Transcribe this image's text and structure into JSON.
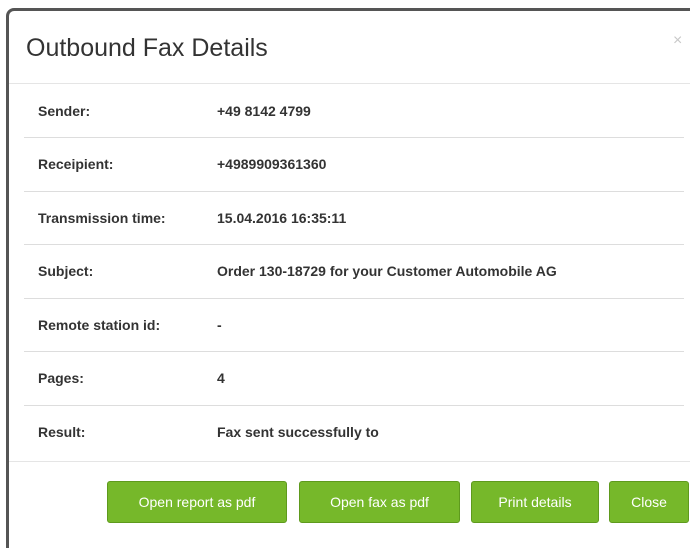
{
  "dialog": {
    "title": "Outbound Fax Details",
    "close_glyph": "×"
  },
  "details": [
    {
      "label": "Sender:",
      "value": "+49 8142 4799"
    },
    {
      "label": "Receipient:",
      "value": "+4989909361360"
    },
    {
      "label": "Transmission time:",
      "value": "15.04.2016 16:35:11"
    },
    {
      "label": "Subject:",
      "value": "Order 130-18729 for your Customer Automobile AG"
    },
    {
      "label": "Remote station id:",
      "value": "-"
    },
    {
      "label": "Pages:",
      "value": "4"
    },
    {
      "label": "Result:",
      "value": "Fax sent successfully to"
    }
  ],
  "buttons": {
    "open_report": "Open report as pdf",
    "open_fax": "Open fax as pdf",
    "print_details": "Print details",
    "close": "Close"
  },
  "colors": {
    "button_green": "#76b82a",
    "title_text": "#333333"
  }
}
